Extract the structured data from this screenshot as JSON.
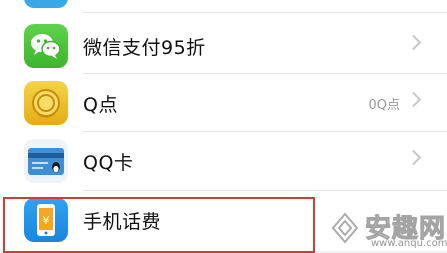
{
  "rows": [
    {
      "label": "微信支付95折",
      "icon": "wechat-icon",
      "value": ""
    },
    {
      "label": "Q点",
      "icon": "qpoint-coin-icon",
      "value": "0Q点"
    },
    {
      "label": "QQ卡",
      "icon": "qq-card-icon",
      "value": ""
    },
    {
      "label": "手机话费",
      "icon": "phone-bill-icon",
      "value": ""
    }
  ],
  "colors": {
    "highlight_border": "#d33b3b",
    "wechat_green": "#3cb52d",
    "qpoint_gold": "#e4ad14",
    "phone_blue": "#1b86dc"
  },
  "watermark": {
    "text": "安趣网",
    "url": "www.anqu.com"
  }
}
